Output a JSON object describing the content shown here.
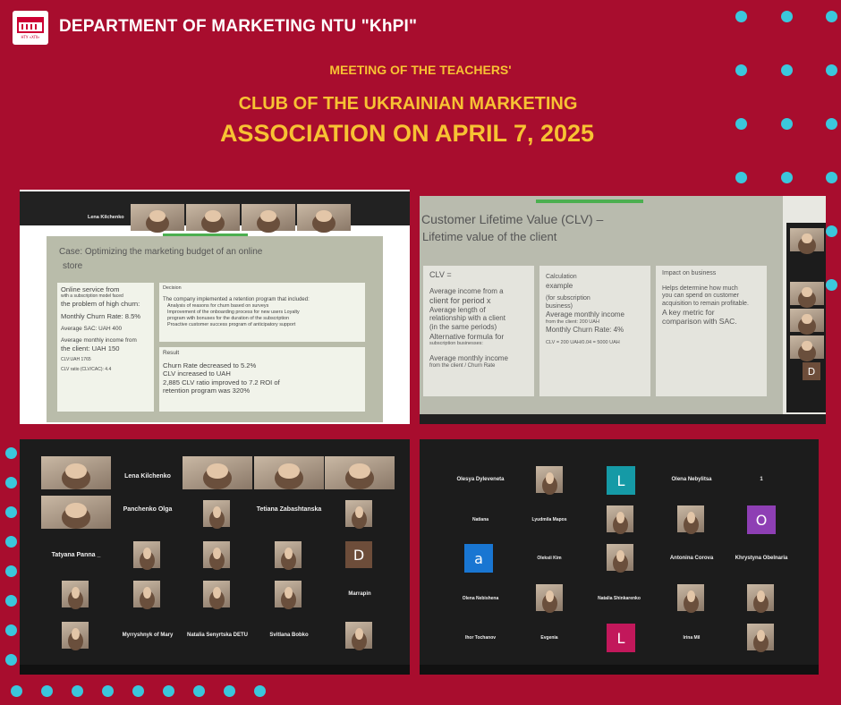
{
  "colors": {
    "background": "#a80d2e",
    "title_accent": "#f7c233",
    "dots": "#3bc7dc"
  },
  "header": {
    "department": "DEPARTMENT OF MARKETING NTU \"KhPI\"",
    "line1": "MEETING OF THE TEACHERS'",
    "line2": "CLUB OF THE UKRAINIAN MARKETING",
    "line3": "ASSOCIATION ON APRIL 7, 2025"
  },
  "shot1": {
    "names": [
      "Lena Kilchenko"
    ],
    "slide_title": "Case: Optimizing the marketing budget of an online",
    "slide_title2": "store",
    "left_card": [
      "Online service from",
      "with a subscription model faced",
      "the problem of high churn:",
      "Monthly Churn Rate: 8.5%",
      "Average SAC: UAH 400",
      "Average monthly income from",
      "the client: UAH 150",
      "CLV:UAH 1765",
      "CLV ratio (CLV/CAC): 4.4"
    ],
    "decision": [
      "Decision",
      "The company implemented a retention program that included:",
      "Analysis of reasons for churn based on surveys",
      "Improvement of the onboarding process for new users Loyalty",
      "program with bonuses for the duration of the subscription",
      "Proactive customer success program of anticipatory support"
    ],
    "result": [
      "Result",
      "Churn Rate decreased to 5.2%",
      "CLV increased to UAH",
      "2,885 CLV ratio improved to 7.2 ROI of",
      "retention program was 320%"
    ]
  },
  "shot2": {
    "title1": "Customer Lifetime Value (CLV) –",
    "title2": "Lifetime value of the client",
    "col1": [
      "CLV =",
      "Average income from a",
      "client for period x",
      "Average length of",
      "relationship with a client",
      "(in the same periods)",
      "Alternative formula for",
      "subscription businesses:",
      "Average monthly income",
      "from the client / Churn Rate"
    ],
    "col2": [
      "Calculation",
      "example",
      "(for subscription",
      "business)",
      "Average monthly income",
      "from the client: 200 UAH",
      "Monthly Churn Rate: 4%",
      "CLV = 200 UAH/0.04 = 5000 UAH"
    ],
    "col3": [
      "Impact on business",
      "Helps determine how much",
      "you can spend on customer",
      "acquisition to remain profitable.",
      "A key metric for",
      "comparison with SAC."
    ],
    "side_avatar": "D"
  },
  "shot3": {
    "names": [
      "Lena Kilchenko",
      "Panchenko Olga",
      "Tetiana Zabashtanska",
      "Tatyana Panna _",
      "Marrapin",
      "Myrryshnyk of Mary",
      "Natalia Senyrtska DETU",
      "Svitlana Bobko"
    ],
    "avatar": "D"
  },
  "shot4": {
    "names": [
      "Olesya Dyleveneta",
      "Olena Nebylitsa",
      "1",
      "Natiana",
      "Lyudmila Mapos",
      "Oleksii Kim",
      "Antonina Corova",
      "Khrystyna Obelnaria",
      "Olena Nebishena",
      "Natalia Shinkarenko",
      "Ihor Tochanov",
      "Evgenia",
      "Irina Mil"
    ],
    "avatars": [
      "L",
      "O",
      "a",
      "L"
    ]
  }
}
